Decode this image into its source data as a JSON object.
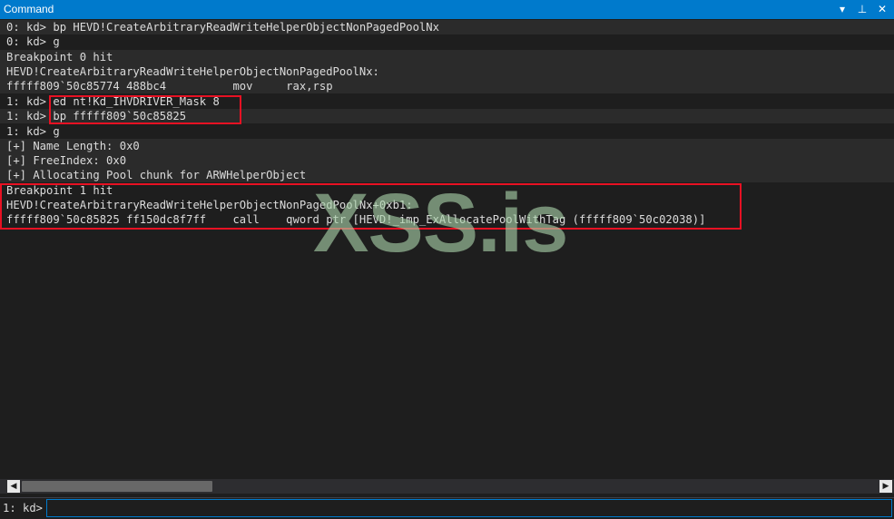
{
  "window": {
    "title": "Command",
    "controls": {
      "dropdown": "▾",
      "pin": "⊥",
      "close": "✕"
    }
  },
  "output_lines": [
    "0: kd> bp HEVD!CreateArbitraryReadWriteHelperObjectNonPagedPoolNx",
    "0: kd> g",
    "Breakpoint 0 hit",
    "HEVD!CreateArbitraryReadWriteHelperObjectNonPagedPoolNx:",
    "fffff809`50c85774 488bc4          mov     rax,rsp",
    "1: kd> ed nt!Kd_IHVDRIVER_Mask 8",
    "1: kd> bp fffff809`50c85825",
    "1: kd> g",
    "[+] Name Length: 0x0",
    "[+] FreeIndex: 0x0",
    "[+] Allocating Pool chunk for ARWHelperObject",
    "Breakpoint 1 hit",
    "HEVD!CreateArbitraryReadWriteHelperObjectNonPagedPoolNx+0xb1:",
    "fffff809`50c85825 ff150dc8f7ff    call    qword ptr [HEVD!_imp_ExAllocatePoolWithTag (fffff809`50c02038)]"
  ],
  "watermark": "XSS.is",
  "highlight_color": "#e81123",
  "command_bar": {
    "prompt": "1: kd>",
    "value": ""
  },
  "scrollbar": {
    "left_arrow": "◀",
    "right_arrow": "▶"
  }
}
